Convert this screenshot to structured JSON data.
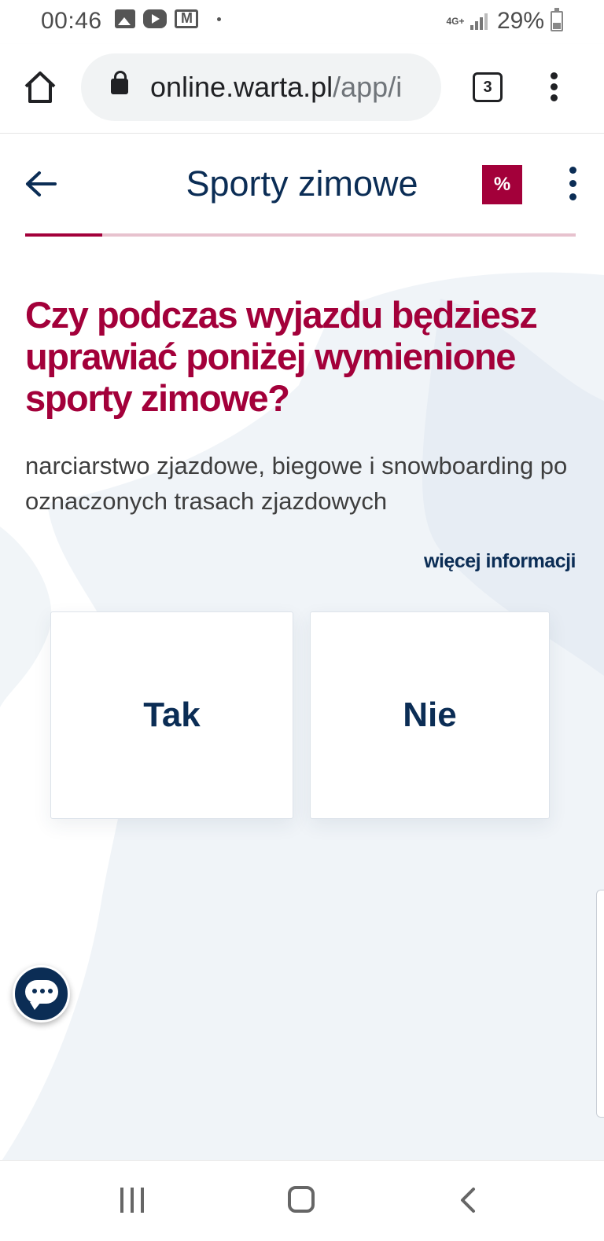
{
  "status_bar": {
    "time": "00:46",
    "network": "4G+",
    "battery": "29%",
    "icons": [
      "gallery-icon",
      "youtube-icon",
      "gmail-icon",
      "dot-icon",
      "signal-icon",
      "battery-icon"
    ]
  },
  "browser": {
    "url_domain": "online.warta.pl",
    "url_path": "/app/i",
    "tab_count": "3",
    "icons": [
      "home-icon",
      "lock-icon",
      "menu-dots-icon"
    ]
  },
  "header": {
    "title": "Sporty zimowe",
    "discount_label": "%",
    "progress": 0.14,
    "icons": [
      "arrow-left-icon",
      "more-vertical-icon"
    ]
  },
  "question": {
    "title": "Czy podczas wyjazdu będziesz uprawiać poniżej wymienione sporty zimowe?",
    "description": "narciarstwo zjazdowe, biegowe i snowboarding po oznaczonych trasach zjazdowych",
    "more_info": "więcej informacji"
  },
  "options": {
    "yes": "Tak",
    "no": "Nie"
  },
  "chat": {
    "icon": "chat-bubble-icon"
  },
  "nav": {
    "icons": [
      "recent-apps-icon",
      "home-button-icon",
      "back-icon"
    ]
  },
  "colors": {
    "brand_red": "#a3003a",
    "brand_navy": "#0b2d55",
    "progress_track": "#e7c2ce"
  }
}
